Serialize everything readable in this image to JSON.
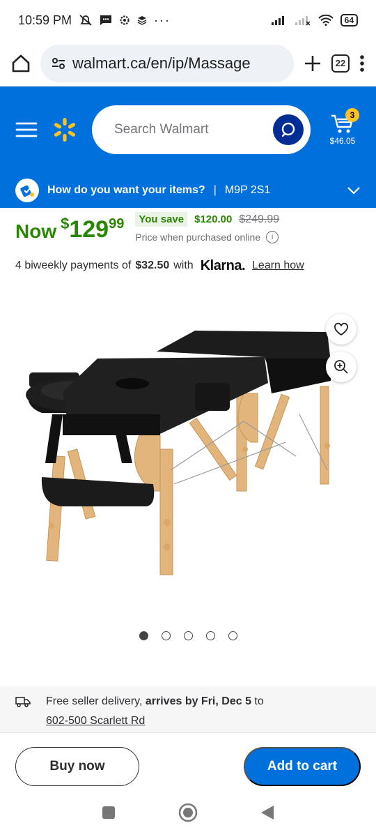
{
  "status_bar": {
    "time": "10:59 PM",
    "battery": "64"
  },
  "browser": {
    "url": "walmart.ca/en/ip/Massage",
    "tab_count": "22"
  },
  "header": {
    "search_placeholder": "Search Walmart",
    "cart_badge": "3",
    "cart_total": "$46.05"
  },
  "delivery_bar": {
    "question": "How do you want your items?",
    "separator": "|",
    "postal_code": "M9P 2S1"
  },
  "price": {
    "now_label": "Now",
    "dollar_sign": "$",
    "whole": "129",
    "cents": "99",
    "you_save_label": "You save",
    "save_amount": "$120.00",
    "was_price": "$249.99",
    "online_note": "Price when purchased online"
  },
  "klarna": {
    "prefix": "4 biweekly payments of",
    "amount": "$32.50",
    "with": "with",
    "brand": "Klarna.",
    "learn_link": "Learn how"
  },
  "carousel": {
    "dot_count": 5,
    "active_index": 0
  },
  "delivery_info": {
    "prefix": "Free seller delivery,",
    "arrival": "arrives by Fri, Dec 5",
    "to": "to",
    "address": "602-500 Scarlett Rd"
  },
  "actions": {
    "buy_now": "Buy now",
    "add_to_cart": "Add to cart"
  },
  "colors": {
    "brand_blue": "#0071dc",
    "spark_yellow": "#ffc220",
    "price_green": "#2a8703",
    "dark_blue": "#002d95"
  }
}
